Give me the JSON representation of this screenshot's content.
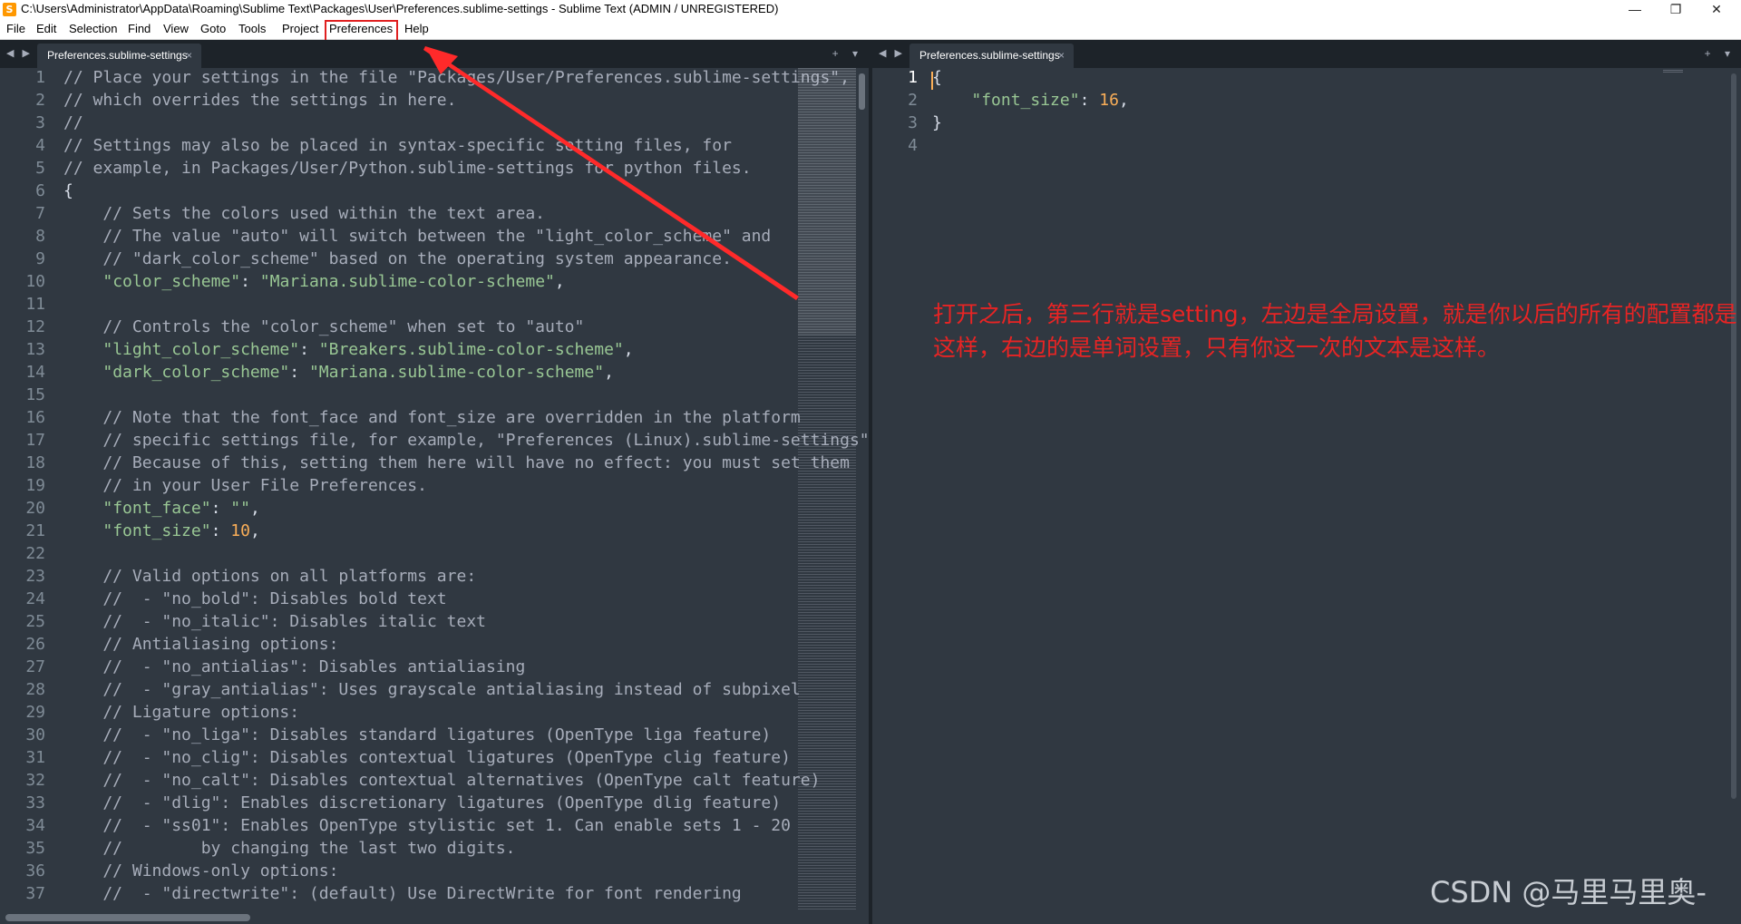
{
  "window": {
    "title": "C:\\Users\\Administrator\\AppData\\Roaming\\Sublime Text\\Packages\\User\\Preferences.sublime-settings - Sublime Text (ADMIN / UNREGISTERED)",
    "icon_glyph": "S",
    "minimize_glyph": "—",
    "maximize_glyph": "❐",
    "close_glyph": "✕"
  },
  "menu": {
    "items": [
      "File",
      "Edit",
      "Selection",
      "Find",
      "View",
      "Goto",
      "Tools",
      "Project",
      "Preferences",
      "Help"
    ],
    "highlighted": "Preferences"
  },
  "tabs": {
    "nav_arrows": "◀ ▶",
    "tools": "+ ▾",
    "close_glyph": "×",
    "left": {
      "label": "Preferences.sublime-settings"
    },
    "right": {
      "label": "Preferences.sublime-settings"
    }
  },
  "editor_left": {
    "lines": [
      [
        {
          "t": "comment",
          "s": "// Place your settings in the file \"Packages/User/Preferences.sublime-settings\","
        }
      ],
      [
        {
          "t": "comment",
          "s": "// which overrides the settings in here."
        }
      ],
      [
        {
          "t": "comment",
          "s": "//"
        }
      ],
      [
        {
          "t": "comment",
          "s": "// Settings may also be placed in syntax-specific setting files, for"
        }
      ],
      [
        {
          "t": "comment",
          "s": "// example, in Packages/User/Python.sublime-settings for python files."
        }
      ],
      [
        {
          "t": "brace",
          "s": "{"
        }
      ],
      [
        {
          "t": "comment",
          "s": "    // Sets the colors used within the text area."
        }
      ],
      [
        {
          "t": "comment",
          "s": "    // The value \"auto\" will switch between the \"light_color_scheme\" and"
        }
      ],
      [
        {
          "t": "comment",
          "s": "    // \"dark_color_scheme\" based on the operating system appearance."
        }
      ],
      [
        {
          "t": "punct",
          "s": "    "
        },
        {
          "t": "string",
          "s": "\"color_scheme\""
        },
        {
          "t": "punct",
          "s": ": "
        },
        {
          "t": "string",
          "s": "\"Mariana.sublime-color-scheme\""
        },
        {
          "t": "punct",
          "s": ","
        }
      ],
      [],
      [
        {
          "t": "comment",
          "s": "    // Controls the \"color_scheme\" when set to \"auto\""
        }
      ],
      [
        {
          "t": "punct",
          "s": "    "
        },
        {
          "t": "string",
          "s": "\"light_color_scheme\""
        },
        {
          "t": "punct",
          "s": ": "
        },
        {
          "t": "string",
          "s": "\"Breakers.sublime-color-scheme\""
        },
        {
          "t": "punct",
          "s": ","
        }
      ],
      [
        {
          "t": "punct",
          "s": "    "
        },
        {
          "t": "string",
          "s": "\"dark_color_scheme\""
        },
        {
          "t": "punct",
          "s": ": "
        },
        {
          "t": "string",
          "s": "\"Mariana.sublime-color-scheme\""
        },
        {
          "t": "punct",
          "s": ","
        }
      ],
      [],
      [
        {
          "t": "comment",
          "s": "    // Note that the font_face and font_size are overridden in the platform"
        }
      ],
      [
        {
          "t": "comment",
          "s": "    // specific settings file, for example, \"Preferences (Linux).sublime-settings\"."
        }
      ],
      [
        {
          "t": "comment",
          "s": "    // Because of this, setting them here will have no effect: you must set them"
        }
      ],
      [
        {
          "t": "comment",
          "s": "    // in your User File Preferences."
        }
      ],
      [
        {
          "t": "punct",
          "s": "    "
        },
        {
          "t": "string",
          "s": "\"font_face\""
        },
        {
          "t": "punct",
          "s": ": "
        },
        {
          "t": "string",
          "s": "\"\""
        },
        {
          "t": "punct",
          "s": ","
        }
      ],
      [
        {
          "t": "punct",
          "s": "    "
        },
        {
          "t": "string",
          "s": "\"font_size\""
        },
        {
          "t": "punct",
          "s": ": "
        },
        {
          "t": "number",
          "s": "10"
        },
        {
          "t": "punct",
          "s": ","
        }
      ],
      [],
      [
        {
          "t": "comment",
          "s": "    // Valid options on all platforms are:"
        }
      ],
      [
        {
          "t": "comment",
          "s": "    //  - \"no_bold\": Disables bold text"
        }
      ],
      [
        {
          "t": "comment",
          "s": "    //  - \"no_italic\": Disables italic text"
        }
      ],
      [
        {
          "t": "comment",
          "s": "    // Antialiasing options:"
        }
      ],
      [
        {
          "t": "comment",
          "s": "    //  - \"no_antialias\": Disables antialiasing"
        }
      ],
      [
        {
          "t": "comment",
          "s": "    //  - \"gray_antialias\": Uses grayscale antialiasing instead of subpixel"
        }
      ],
      [
        {
          "t": "comment",
          "s": "    // Ligature options:"
        }
      ],
      [
        {
          "t": "comment",
          "s": "    //  - \"no_liga\": Disables standard ligatures (OpenType liga feature)"
        }
      ],
      [
        {
          "t": "comment",
          "s": "    //  - \"no_clig\": Disables contextual ligatures (OpenType clig feature)"
        }
      ],
      [
        {
          "t": "comment",
          "s": "    //  - \"no_calt\": Disables contextual alternatives (OpenType calt feature)"
        }
      ],
      [
        {
          "t": "comment",
          "s": "    //  - \"dlig\": Enables discretionary ligatures (OpenType dlig feature)"
        }
      ],
      [
        {
          "t": "comment",
          "s": "    //  - \"ss01\": Enables OpenType stylistic set 1. Can enable sets 1 - 20"
        }
      ],
      [
        {
          "t": "comment",
          "s": "    //        by changing the last two digits."
        }
      ],
      [
        {
          "t": "comment",
          "s": "    // Windows-only options:"
        }
      ],
      [
        {
          "t": "comment",
          "s": "    //  - \"directwrite\": (default) Use DirectWrite for font rendering"
        }
      ]
    ]
  },
  "editor_right": {
    "lines": [
      [
        {
          "t": "brace",
          "s": "{"
        }
      ],
      [
        {
          "t": "punct",
          "s": "    "
        },
        {
          "t": "string",
          "s": "\"font_size\""
        },
        {
          "t": "punct",
          "s": ": "
        },
        {
          "t": "number",
          "s": "16"
        },
        {
          "t": "punct",
          "s": ","
        }
      ],
      [
        {
          "t": "brace",
          "s": "}"
        }
      ],
      []
    ],
    "current_line": 1
  },
  "annotation": {
    "note": "打开之后，第三行就是setting，左边是全局设置，就是你以后的所有的配置都是这样，右边的是单词设置，只有你这一次的文本是这样。",
    "color": "#e82424"
  },
  "watermark": "CSDN @马里马里奥-",
  "colors": {
    "editor_bg": "#303841",
    "tabbar_bg": "#1d2329",
    "comment": "#a7adba",
    "string": "#99c794",
    "number": "#f9ae58",
    "line_number": "#7f8b96"
  }
}
